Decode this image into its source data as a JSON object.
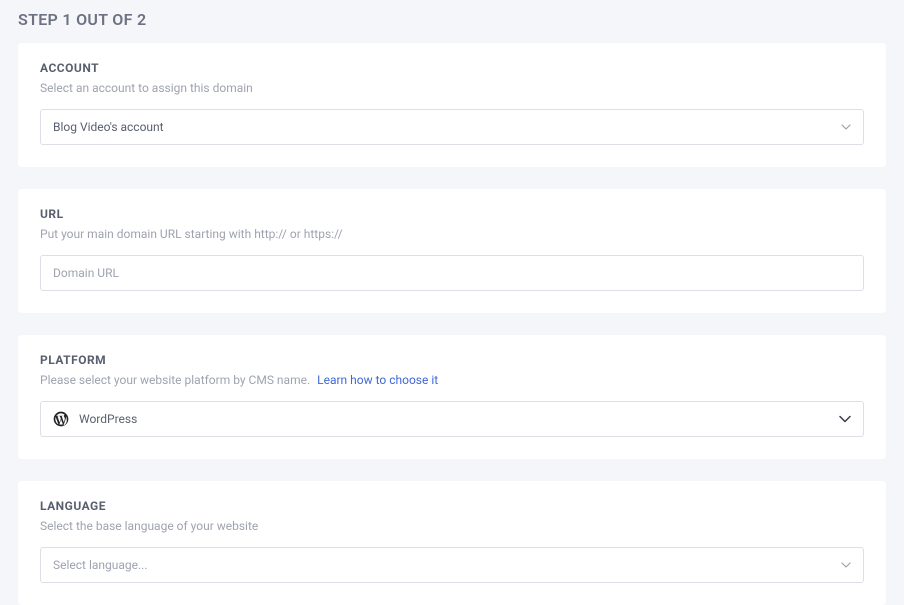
{
  "step_header": "STEP 1 OUT OF 2",
  "account": {
    "title": "ACCOUNT",
    "subtitle": "Select an account to assign this domain",
    "selected": "Blog Video's account"
  },
  "url": {
    "title": "URL",
    "subtitle": "Put your main domain URL starting with http:// or https://",
    "placeholder": "Domain URL"
  },
  "platform": {
    "title": "PLATFORM",
    "subtitle": "Please select your website platform by CMS name.",
    "link_text": "Learn how to choose it",
    "selected": "WordPress",
    "icon": "wordpress-icon"
  },
  "language": {
    "title": "LANGUAGE",
    "subtitle": "Select the base language of your website",
    "placeholder": "Select language..."
  }
}
